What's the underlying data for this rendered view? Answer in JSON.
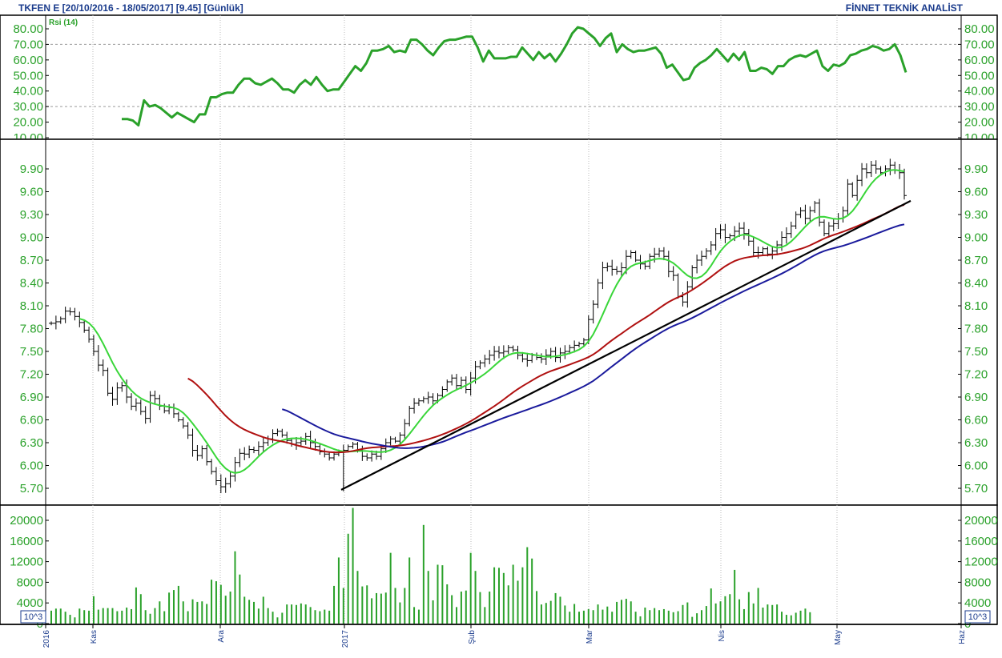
{
  "header": {
    "left": "TKFEN E  [20/10/2016 - 18/05/2017]  [9.45]  [Günlük]",
    "right": "FİNNET TEKNİK ANALİST"
  },
  "chart_data": [
    {
      "type": "line",
      "title": "Rsi (14)",
      "yticks": [
        "80.00",
        "70.00",
        "60.00",
        "50.00",
        "40.00",
        "30.00",
        "20.00",
        "10.00"
      ],
      "ylim": [
        10,
        85
      ],
      "reference_lines": [
        70,
        30
      ],
      "series": [
        {
          "name": "Rsi (14)",
          "color": "#2aa12a",
          "values": [
            22,
            22,
            21,
            18,
            34,
            30,
            31,
            29,
            26,
            23,
            26,
            24,
            22,
            20,
            25,
            25,
            36,
            36,
            38,
            39,
            39,
            44,
            48,
            48,
            45,
            44,
            46,
            48,
            45,
            41,
            41,
            39,
            44,
            47,
            44,
            49,
            44,
            40,
            41,
            41,
            46,
            51,
            56,
            53,
            58,
            66,
            66,
            67,
            69,
            65,
            66,
            65,
            73,
            73,
            70,
            66,
            63,
            68,
            72,
            73,
            73,
            74,
            75,
            75,
            68,
            59,
            66,
            61,
            61,
            61,
            62,
            62,
            68,
            64,
            60,
            65,
            61,
            64,
            59,
            64,
            70,
            77,
            81,
            80,
            77,
            74,
            69,
            74,
            77,
            65,
            70,
            67,
            65,
            66,
            66,
            67,
            68,
            64,
            55,
            57,
            52,
            47,
            48,
            55,
            58,
            60,
            63,
            67,
            63,
            59,
            64,
            60,
            65,
            53,
            53,
            55,
            54,
            51,
            56,
            56,
            60,
            62,
            63,
            62,
            64,
            66,
            56,
            53,
            57,
            56,
            58,
            63,
            64,
            66,
            67,
            69,
            68,
            66,
            67,
            70,
            63,
            52
          ]
        }
      ]
    },
    {
      "type": "bar",
      "subtype": "ohlc",
      "yticks": [
        "9.90",
        "9.60",
        "9.30",
        "9.00",
        "8.70",
        "8.40",
        "8.10",
        "7.80",
        "7.50",
        "7.20",
        "6.90",
        "6.60",
        "6.30",
        "6.00",
        "5.70"
      ],
      "ylim": [
        5.5,
        10.15
      ],
      "x_labels": [
        "2016",
        "Kas",
        "Ara",
        "2017",
        "Şub",
        "Mar",
        "Nis",
        "May",
        "Haz"
      ],
      "closes": [
        7.87,
        7.89,
        7.93,
        8.03,
        8.02,
        7.96,
        7.88,
        7.78,
        7.66,
        7.5,
        7.32,
        7.25,
        6.95,
        6.87,
        7.02,
        7.05,
        6.9,
        6.78,
        6.82,
        6.71,
        6.62,
        6.92,
        6.88,
        6.78,
        6.72,
        6.76,
        6.68,
        6.6,
        6.52,
        6.4,
        6.2,
        6.13,
        6.22,
        6.05,
        5.92,
        5.8,
        5.72,
        5.76,
        5.86,
        6.04,
        6.16,
        6.15,
        6.21,
        6.2,
        6.25,
        6.3,
        6.35,
        6.42,
        6.45,
        6.4,
        6.33,
        6.28,
        6.3,
        6.32,
        6.38,
        6.3,
        6.25,
        6.18,
        6.15,
        6.1,
        6.15,
        6.18,
        6.2,
        6.25,
        6.28,
        6.2,
        6.12,
        6.1,
        6.15,
        6.12,
        6.22,
        6.3,
        6.35,
        6.32,
        6.4,
        6.55,
        6.75,
        6.82,
        6.85,
        6.88,
        6.9,
        6.85,
        6.92,
        7.0,
        7.1,
        7.15,
        7.05,
        7.12,
        7.0,
        7.15,
        7.3,
        7.35,
        7.4,
        7.45,
        7.5,
        7.48,
        7.5,
        7.55,
        7.52,
        7.45,
        7.4,
        7.38,
        7.45,
        7.42,
        7.4,
        7.45,
        7.5,
        7.42,
        7.48,
        7.5,
        7.55,
        7.58,
        7.6,
        7.65,
        7.92,
        8.12,
        8.4,
        8.6,
        8.62,
        8.58,
        8.55,
        8.6,
        8.75,
        8.8,
        8.7,
        8.65,
        8.62,
        8.75,
        8.78,
        8.82,
        8.75,
        8.55,
        8.5,
        8.22,
        8.15,
        8.35,
        8.6,
        8.7,
        8.75,
        8.82,
        8.9,
        9.05,
        9.1,
        9.0,
        9.02,
        9.08,
        9.12,
        9.05,
        8.95,
        8.8,
        8.8,
        8.85,
        8.78,
        8.82,
        8.9,
        9.0,
        9.05,
        9.15,
        9.3,
        9.35,
        9.25,
        9.35,
        9.45,
        9.2,
        9.05,
        9.15,
        9.18,
        9.25,
        9.35,
        9.7,
        9.55,
        9.75,
        9.9,
        9.85,
        9.95,
        9.9,
        9.85,
        9.9,
        9.95,
        9.88,
        9.85,
        9.55
      ],
      "series": [
        {
          "name": "MA short",
          "color": "#39d639"
        },
        {
          "name": "MA medium",
          "color": "#b01010"
        },
        {
          "name": "MA long",
          "color": "#1a1a9c"
        },
        {
          "name": "trendline",
          "color": "#000000",
          "x": [
            0,
            1
          ],
          "values": [
            5.68,
            9.48
          ]
        }
      ]
    },
    {
      "type": "bar",
      "yticks": [
        "20000",
        "16000",
        "12000",
        "8000",
        "4000",
        "0"
      ],
      "ylim": [
        0,
        22500
      ],
      "unit": "10^3",
      "series": [
        {
          "name": "volume",
          "color": "#2aa12a",
          "values": [
            2500,
            2900,
            2900,
            2300,
            1700,
            1200,
            2900,
            2600,
            2500,
            5300,
            2700,
            3000,
            3000,
            3000,
            2400,
            2500,
            3100,
            2800,
            7000,
            5700,
            2600,
            1900,
            3000,
            4300,
            2400,
            6000,
            6500,
            7300,
            4300,
            2400,
            4700,
            4200,
            4300,
            3800,
            8500,
            8200,
            7500,
            5400,
            6200,
            14000,
            9500,
            5200,
            4600,
            4200,
            2900,
            5200,
            3000,
            2300,
            1200,
            2100,
            3700,
            3700,
            3600,
            3900,
            3700,
            3200,
            2600,
            2400,
            2700,
            2500,
            7300,
            12800,
            6900,
            17400,
            22400,
            10200,
            7200,
            7400,
            4900,
            5900,
            5800,
            6000,
            13700,
            6900,
            4100,
            6900,
            12800,
            3200,
            2700,
            19100,
            10200,
            4500,
            11400,
            11300,
            7600,
            5500,
            3200,
            6200,
            6400,
            13700,
            10200,
            6100,
            3200,
            6200,
            10900,
            10800,
            9800,
            7400,
            11400,
            8300,
            10900,
            14800,
            12600,
            6300,
            3700,
            4000,
            4400,
            5900,
            5200,
            3500,
            2300,
            3800,
            2300,
            2500,
            2800,
            2600,
            3700,
            2700,
            3300,
            2300,
            4200,
            4600,
            4800,
            4300,
            2300,
            1400,
            3100,
            2600,
            3000,
            2600,
            2800,
            2500,
            2200,
            2400,
            3600,
            4100,
            1300,
            2000,
            2600,
            3400,
            6800,
            3900,
            4300,
            5300,
            5700,
            10400,
            4700,
            2800,
            6100,
            3900,
            6900,
            3100,
            3700,
            3600,
            3700,
            2300,
            1700,
            1600,
            2100,
            2500,
            2900,
            2200
          ]
        }
      ]
    }
  ]
}
